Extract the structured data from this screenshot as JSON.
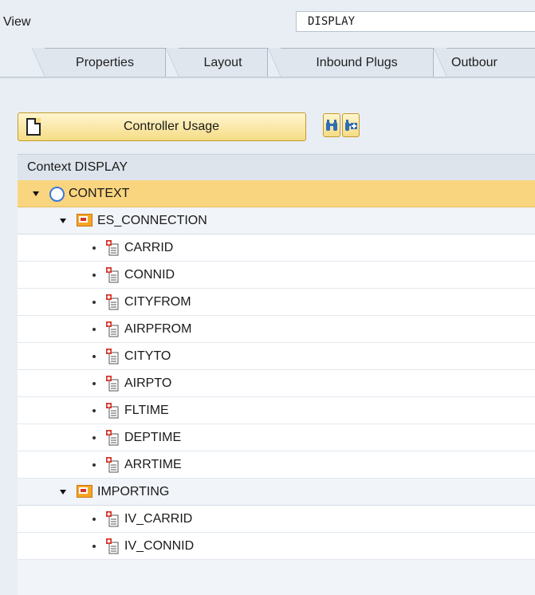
{
  "view": {
    "label": "View",
    "value": "DISPLAY"
  },
  "tabs": [
    "Properties",
    "Layout",
    "Inbound Plugs",
    "Outbour"
  ],
  "toolbar": {
    "controller_usage": "Controller Usage"
  },
  "panel": {
    "title": "Context DISPLAY"
  },
  "tree": {
    "root": "CONTEXT",
    "nodes": [
      {
        "name": "ES_CONNECTION",
        "attributes": [
          "CARRID",
          "CONNID",
          "CITYFROM",
          "AIRPFROM",
          "CITYTO",
          "AIRPTO",
          "FLTIME",
          "DEPTIME",
          "ARRTIME"
        ]
      },
      {
        "name": "IMPORTING",
        "attributes": [
          "IV_CARRID",
          "IV_CONNID"
        ]
      }
    ]
  }
}
